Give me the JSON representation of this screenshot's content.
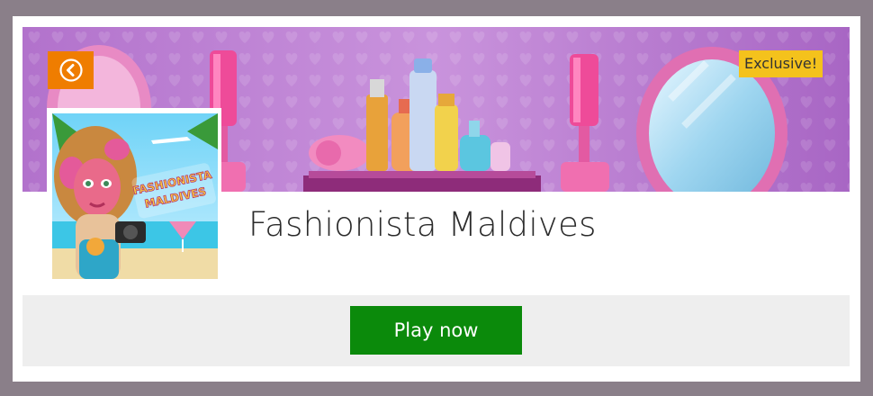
{
  "game": {
    "title": "Fashionista Maldives",
    "badge": "Exclusive!",
    "play_label": "Play now",
    "thumb_logo_line1": "FASHIONISTA",
    "thumb_logo_line2": "MALDIVES"
  },
  "icons": {
    "back": "chevron-left-icon"
  },
  "colors": {
    "page_bg": "#8a7f89",
    "back_button": "#ef7d00",
    "badge": "#f4c21c",
    "play_button": "#0b8a0b",
    "bar_bg": "#eeeeee"
  }
}
